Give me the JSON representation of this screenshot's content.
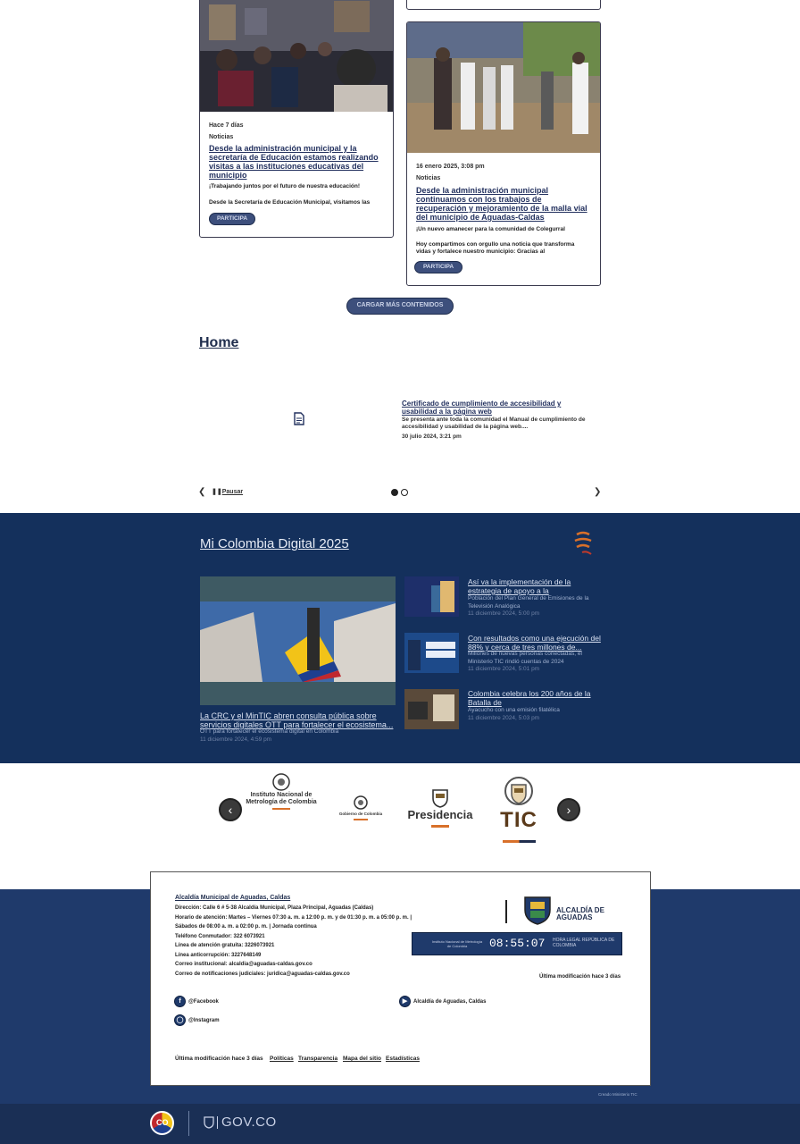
{
  "news": {
    "card1": {
      "time": "Hace 7 días",
      "category": "Noticias",
      "title": "Desde la administración municipal y la secretaría de Educación estamos realizando visitas a las instituciones educativas del municipio",
      "subtitle": "¡Trabajando juntos por el futuro de nuestra educación!",
      "excerpt": "Desde la Secretaría de Educación Municipal, visitamos las",
      "button": "PARTICIPA"
    },
    "card2": {
      "time": "16 enero 2025, 3:08 pm",
      "category": "Noticias",
      "title": "Desde la administración municipal continuamos con los trabajos de recuperación y mejoramiento de la malla vial del municipio de Aguadas-Caldas",
      "subtitle": "¡Un nuevo amanecer para la comunidad de Colegurral",
      "excerpt": "Hoy compartimos con orgullo una noticia que transforma vidas y fortalece nuestro municipio: Gracias al",
      "button": "PARTICIPA"
    },
    "load_more": "CARGAR MÁS CONTENIDOS"
  },
  "home": {
    "title": "Home",
    "doc_icon": "document-icon",
    "cert_title": "Certificado de cumplimiento de accesibilidad y usabilidad a la página web",
    "cert_desc": "Se presenta ante toda la comunidad el Manual de cumplimiento de accesibilidad y usabilidad de la página web....",
    "cert_date": "30 julio 2024, 3:21 pm",
    "pause_label": "Pausar"
  },
  "mcd": {
    "title": "Mi Colombia Digital 2025",
    "main": {
      "title": "La CRC y el MinTIC abren consulta pública sobre servicios digitales OTT para fortalecer el ecosistema...",
      "subtitle": "OTT para fortalecer el ecosistema digital en Colombia",
      "date": "11 diciembre 2024, 4:59 pm"
    },
    "items": [
      {
        "title": "Así va la implementación de la estrategia de apoyo a la",
        "subtitle": "Población del Plan General de Emisiones de la Televisión Analógica",
        "date": "11 diciembre 2024, 5:00 pm",
        "thumb_text": "Apoyo de tdt para pasar a la TDT"
      },
      {
        "title": "Con resultados como una ejecución del 88% y cerca de tres millones de...",
        "subtitle": "Millones de nuevas personas conectadas, el Ministerio TIC rindió cuentas de 2024",
        "date": "11 diciembre 2024, 5:01 pm",
        "thumb_text": "Rendición de cuentas"
      },
      {
        "title": "Colombia celebra los 200 años de la Batalla de",
        "subtitle": "Ayacucho con una emisión filatélica",
        "date": "11 diciembre 2024, 5:03 pm",
        "thumb_text": "4-72"
      }
    ]
  },
  "logos": {
    "inm": "Instituto Nacional de Metrología de Colombia",
    "gob": "Gobierno de Colombia",
    "presidencia": "Presidencia",
    "tic": "TIC"
  },
  "footer": {
    "org": "Alcaldía Municipal de Aguadas, Caldas",
    "lines": [
      "Dirección: Calle 6 # 5-38 Alcaldía Municipal, Plaza Principal, Aguadas (Caldas)",
      "Horario de atención: Martes – Viernes 07:30 a. m. a 12:00 p. m. y de 01:30 p. m. a 05:00 p. m. |",
      "Sábados de 08:00 a. m. a 02:00 p. m. | Jornada continua",
      "Teléfono Conmutador: 322 6073921",
      "Línea de atención gratuita: 3226073921",
      "Línea anticorrupción: 3227648149",
      "Correo institucional: alcaldia@aguadas-caldas.gov.co",
      "Correo de notificaciones judiciales: juridica@aguadas-caldas.gov.co"
    ],
    "logo_text": "ALCALDÍA DE AGUADAS",
    "clock_time": "08:55:07",
    "clock_label": "HORA LEGAL REPÚBLICA DE COLOMBIA",
    "clock_org": "Instituto Nacional de Metrología de Colombia",
    "last_modified_right": "Última modificación hace 3 días",
    "facebook": "@Facebook",
    "instagram": "@Instagram",
    "youtube": "Alcaldía de Aguadas, Caldas",
    "last_modified_bottom": "Última modificación hace 3 días",
    "links": [
      "Políticas",
      "Transparencia",
      "Mapa del sitio",
      "Estadísticas"
    ],
    "credit": "Creado Ministerio TIC",
    "gov_co": "GOV.CO",
    "colombia_label": "CO"
  },
  "colors": {
    "navy": "#14305c",
    "footer": "#1f3a6b",
    "pill": "#3d4f7c",
    "accent_orange": "#d8702a"
  }
}
